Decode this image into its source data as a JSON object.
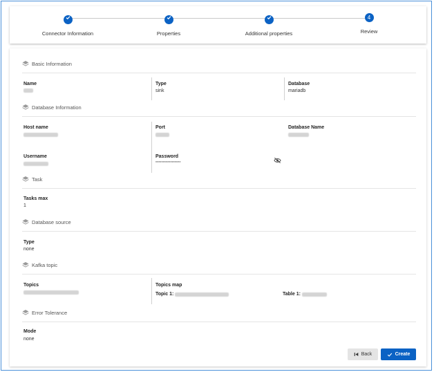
{
  "stepper": {
    "steps": [
      {
        "label": "Connector Information",
        "state": "done"
      },
      {
        "label": "Properties",
        "state": "done"
      },
      {
        "label": "Additional properties",
        "state": "done"
      },
      {
        "label": "Review",
        "state": "active",
        "number": "4"
      }
    ]
  },
  "sections": {
    "basic": {
      "title": "Basic Information",
      "name_label": "Name",
      "type_label": "Type",
      "type_value": "sink",
      "database_label": "Database",
      "database_value": "mariadb"
    },
    "database": {
      "title": "Database Information",
      "host_label": "Host name",
      "port_label": "Port",
      "dbname_label": "Database Name",
      "username_label": "Username",
      "password_label": "Password",
      "password_value": "*****************"
    },
    "task": {
      "title": "Task",
      "tasks_max_label": "Tasks max",
      "tasks_max_value": "1"
    },
    "source": {
      "title": "Database source",
      "type_label": "Type",
      "type_value": "none"
    },
    "kafka": {
      "title": "Kafka topic",
      "topics_label": "Topics",
      "topics_map_label": "Topics map",
      "topic1_label": "Topic 1:",
      "table1_label": "Table 1:"
    },
    "error": {
      "title": "Error Tolerance",
      "mode_label": "Mode",
      "mode_value": "none"
    }
  },
  "buttons": {
    "back_label": "Back",
    "create_label": "Create"
  },
  "colors": {
    "accent": "#0b62c4",
    "border": "#4a90d9"
  }
}
